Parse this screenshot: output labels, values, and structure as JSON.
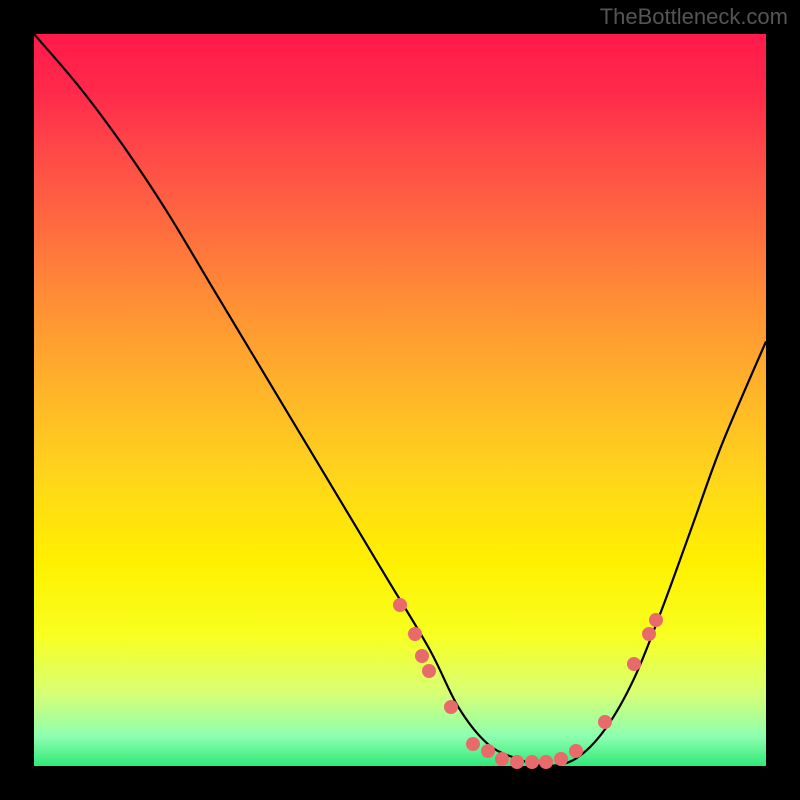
{
  "watermark": "TheBottleneck.com",
  "chart_data": {
    "type": "line",
    "title": "",
    "xlabel": "",
    "ylabel": "",
    "xlim": [
      0,
      100
    ],
    "ylim": [
      0,
      100
    ],
    "series": [
      {
        "name": "curve",
        "x": [
          0,
          6,
          12,
          18,
          24,
          30,
          36,
          42,
          48,
          54,
          58,
          62,
          66,
          70,
          74,
          78,
          82,
          86,
          90,
          94,
          100
        ],
        "y": [
          100,
          93,
          85,
          76,
          66,
          56,
          46,
          36,
          26,
          16,
          8,
          3,
          1,
          0,
          1,
          5,
          12,
          22,
          33,
          44,
          58
        ]
      }
    ],
    "points": [
      {
        "x": 50,
        "y": 22
      },
      {
        "x": 52,
        "y": 18
      },
      {
        "x": 53,
        "y": 15
      },
      {
        "x": 54,
        "y": 13
      },
      {
        "x": 57,
        "y": 8
      },
      {
        "x": 60,
        "y": 3
      },
      {
        "x": 62,
        "y": 2
      },
      {
        "x": 64,
        "y": 1
      },
      {
        "x": 66,
        "y": 0.5
      },
      {
        "x": 68,
        "y": 0.5
      },
      {
        "x": 70,
        "y": 0.5
      },
      {
        "x": 72,
        "y": 1
      },
      {
        "x": 74,
        "y": 2
      },
      {
        "x": 78,
        "y": 6
      },
      {
        "x": 82,
        "y": 14
      },
      {
        "x": 84,
        "y": 18
      },
      {
        "x": 85,
        "y": 20
      }
    ],
    "gradient_colors": {
      "top": "#ff1a4a",
      "mid": "#ffd41c",
      "bottom": "#30e878"
    }
  }
}
